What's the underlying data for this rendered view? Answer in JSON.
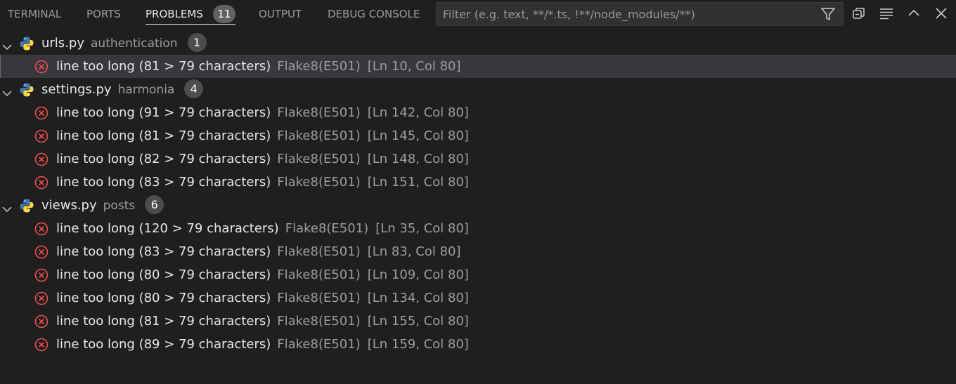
{
  "tabs": [
    {
      "label": "TERMINAL"
    },
    {
      "label": "PORTS"
    },
    {
      "label": "PROBLEMS",
      "badge": "11"
    },
    {
      "label": "OUTPUT"
    },
    {
      "label": "DEBUG CONSOLE"
    }
  ],
  "filter": {
    "placeholder": "Filter (e.g. text, **/*.ts, !**/node_modules/**)",
    "value": ""
  },
  "toolbar_icons": [
    "filter-icon",
    "collapse-all-icon",
    "view-as-list-icon",
    "maximize-panel-icon",
    "close-panel-icon"
  ],
  "colors": {
    "error": "#f14c4c",
    "python_blue": "#3e7ab7",
    "python_yellow": "#ffd43b",
    "selection": "#37373d"
  },
  "groups": [
    {
      "file": "urls.py",
      "dir": "authentication",
      "count": "1",
      "problems": [
        {
          "message": "line too long (81 > 79 characters)",
          "source": "Flake8(E501)",
          "location": "[Ln 10, Col 80]",
          "selected": true
        }
      ]
    },
    {
      "file": "settings.py",
      "dir": "harmonia",
      "count": "4",
      "problems": [
        {
          "message": "line too long (91 > 79 characters)",
          "source": "Flake8(E501)",
          "location": "[Ln 142, Col 80]"
        },
        {
          "message": "line too long (81 > 79 characters)",
          "source": "Flake8(E501)",
          "location": "[Ln 145, Col 80]"
        },
        {
          "message": "line too long (82 > 79 characters)",
          "source": "Flake8(E501)",
          "location": "[Ln 148, Col 80]"
        },
        {
          "message": "line too long (83 > 79 characters)",
          "source": "Flake8(E501)",
          "location": "[Ln 151, Col 80]"
        }
      ]
    },
    {
      "file": "views.py",
      "dir": "posts",
      "count": "6",
      "problems": [
        {
          "message": "line too long (120 > 79 characters)",
          "source": "Flake8(E501)",
          "location": "[Ln 35, Col 80]"
        },
        {
          "message": "line too long (83 > 79 characters)",
          "source": "Flake8(E501)",
          "location": "[Ln 83, Col 80]"
        },
        {
          "message": "line too long (80 > 79 characters)",
          "source": "Flake8(E501)",
          "location": "[Ln 109, Col 80]"
        },
        {
          "message": "line too long (80 > 79 characters)",
          "source": "Flake8(E501)",
          "location": "[Ln 134, Col 80]"
        },
        {
          "message": "line too long (81 > 79 characters)",
          "source": "Flake8(E501)",
          "location": "[Ln 155, Col 80]"
        },
        {
          "message": "line too long (89 > 79 characters)",
          "source": "Flake8(E501)",
          "location": "[Ln 159, Col 80]"
        }
      ]
    }
  ]
}
